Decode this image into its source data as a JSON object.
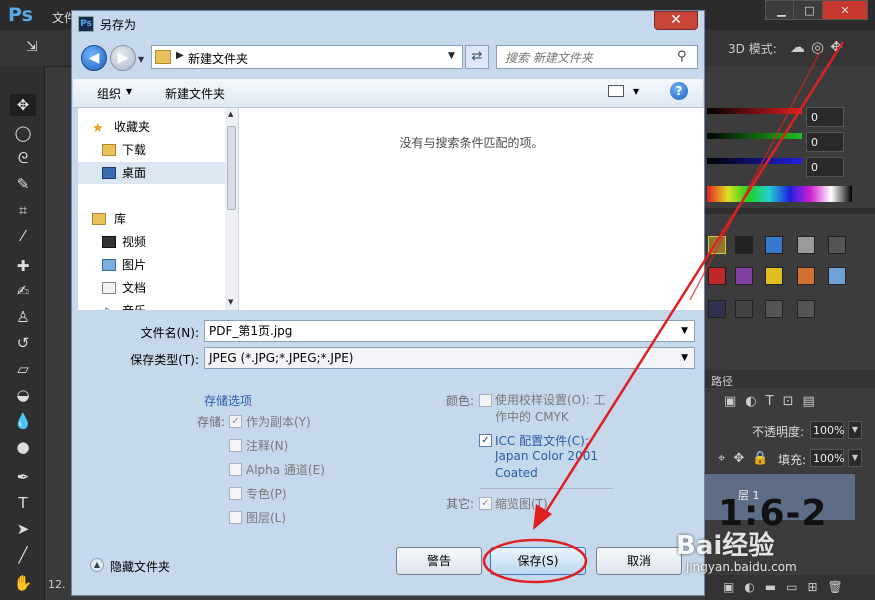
{
  "photoshop": {
    "logo": "Ps",
    "menu_file": "文件",
    "three_d_mode": "3D 模式:",
    "status_zoom": "12.",
    "color_values": [
      "0",
      "0",
      "0"
    ],
    "layers_tab": "路径",
    "opacity_label": "不透明度:",
    "opacity_value": "100%",
    "fill_label": "填充:",
    "fill_value": "100%",
    "layer_name": "层 1",
    "layer_thumb_text": "1:6-2",
    "window_buttons": [
      "▁",
      "□",
      "✕"
    ]
  },
  "dialog": {
    "title": "另存为",
    "close": "✕",
    "address_path": "新建文件夹",
    "search_placeholder": "搜索 新建文件夹",
    "organize": "组织",
    "new_folder": "新建文件夹",
    "help": "?",
    "empty_message": "没有与搜索条件匹配的项。",
    "nav_items": {
      "favorites": "收藏夹",
      "downloads": "下载",
      "desktop": "桌面",
      "libraries": "库",
      "videos": "视频",
      "pictures": "图片",
      "documents": "文档",
      "music": "音乐"
    },
    "file_name_label": "文件名(N):",
    "file_name_value": "PDF_第1页.jpg",
    "save_type_label": "保存类型(T):",
    "save_type_value": "JPEG (*.JPG;*.JPEG;*.JPE)",
    "storage_options": "存储选项",
    "save_label": "存储:",
    "as_copy": "作为副本(Y)",
    "annotations": "注释(N)",
    "alpha_channels": "Alpha 通道(E)",
    "spot_colors": "专色(P)",
    "layers": "图层(L)",
    "color_label": "颜色:",
    "use_proof_setup": "使用校样设置(O):  工",
    "use_proof_setup_2": "作中的 CMYK",
    "icc_profile": "ICC 配置文件(C):",
    "icc_line2": "Japan Color 2001",
    "icc_line3": "Coated",
    "other_label": "其它:",
    "thumbnail": "缩览图(T)",
    "hide_folders": "隐藏文件夹",
    "warning_button": "警告",
    "save_button": "保存(S)",
    "cancel_button": "取消"
  },
  "watermark": {
    "brand": "Bai经验",
    "url": "jingyan.baidu.com"
  },
  "colors": {
    "annotation_red": "#e02020",
    "dialog_bg": "#c6d8ec"
  }
}
